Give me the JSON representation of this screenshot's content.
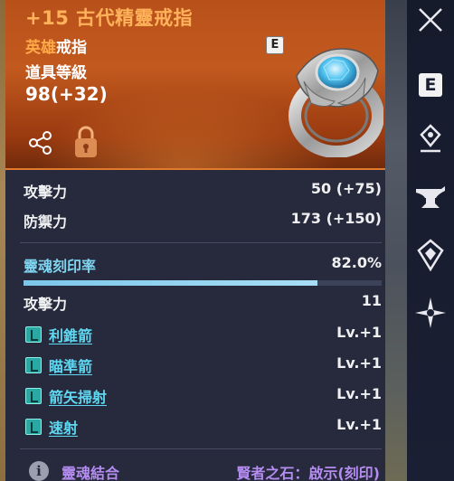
{
  "item": {
    "title": "+15 古代精靈戒指",
    "grade_prefix": "英雄",
    "type": "戒指",
    "level_label": "道具等級",
    "level_value": "98(+32)",
    "badge": "E"
  },
  "stats": [
    {
      "label": "攻擊力",
      "value": "50 (+75)"
    },
    {
      "label": "防禦力",
      "value": "173 (+150)"
    }
  ],
  "soul": {
    "label": "靈魂刻印率",
    "value": "82.0%",
    "progress": 0.82,
    "attack_label": "攻擊力",
    "attack_value": "11"
  },
  "skills": [
    {
      "name": "利錐箭",
      "level": "Lv.+1"
    },
    {
      "name": "瞄準箭",
      "level": "Lv.+1"
    },
    {
      "name": "箭矢掃射",
      "level": "Lv.+1"
    },
    {
      "name": "速射",
      "level": "Lv.+1"
    }
  ],
  "footer": {
    "soul_combine": "靈魂結合",
    "stone": "賢者之石：啟示(刻印)"
  },
  "sidebar": {
    "e_label": "E",
    "icons": [
      "close-icon",
      "e-icon",
      "pin-icon",
      "anvil-icon",
      "gem-icon",
      "star-icon"
    ]
  },
  "colors": {
    "title": "#ffb25a",
    "hero": "#ffa948",
    "soul_label": "#7fd4f0",
    "skill_link": "#5fd8f2",
    "stone": "#b58cf0"
  }
}
